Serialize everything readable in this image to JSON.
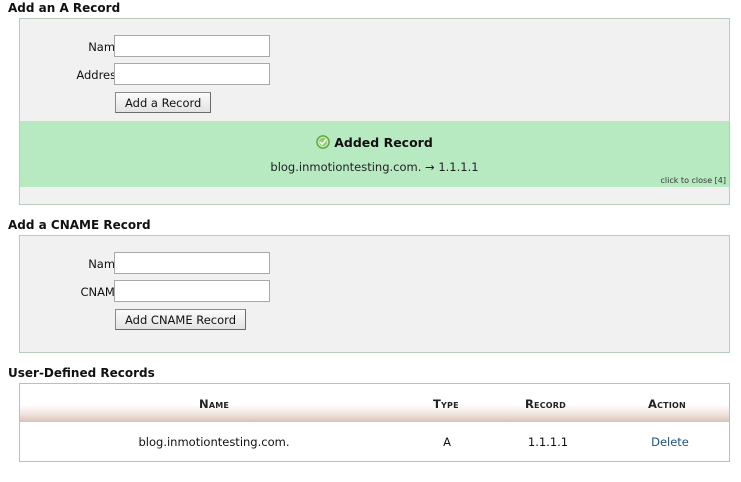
{
  "a_record": {
    "title": "Add an A Record",
    "name_label": "Name:",
    "name_value": "",
    "address_label": "Address:",
    "address_value": "",
    "submit_label": "Add a Record"
  },
  "notice": {
    "title": "Added Record",
    "detail": "blog.inmotiontesting.com. → 1.1.1.1",
    "close_text": "click to close [4]",
    "icon": "check-circle-icon",
    "background": "#b8eac2"
  },
  "cname_record": {
    "title": "Add a CNAME Record",
    "name_label": "Name:",
    "name_value": "",
    "cname_label": "CNAME:",
    "cname_value": "",
    "submit_label": "Add CNAME Record"
  },
  "records": {
    "title": "User-Defined Records",
    "columns": [
      "Name",
      "Type",
      "Record",
      "Action"
    ],
    "rows": [
      {
        "name": "blog.inmotiontesting.com.",
        "type": "A",
        "record": "1.1.1.1",
        "action": "Delete"
      }
    ]
  }
}
